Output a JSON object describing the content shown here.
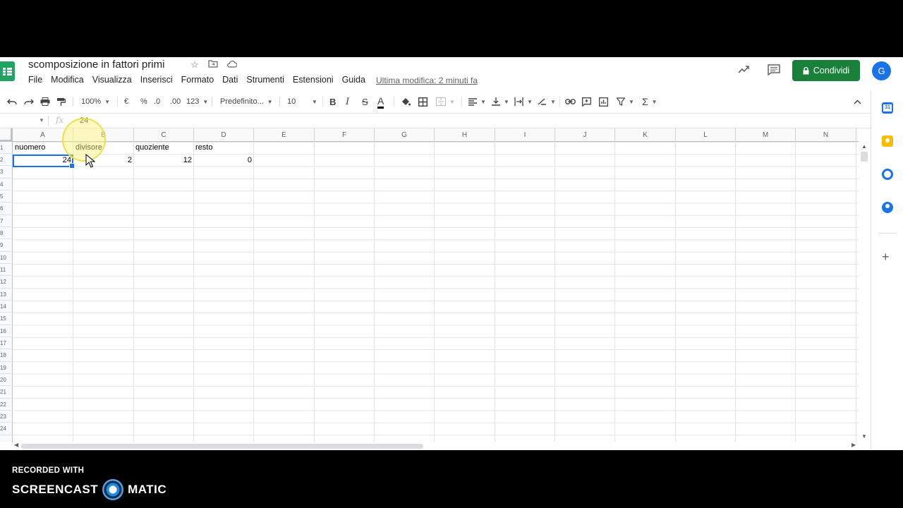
{
  "document": {
    "title": "scomposizione in fattori primi",
    "last_edit": "Ultima modifica: 2 minuti fa"
  },
  "menu": [
    "File",
    "Modifica",
    "Visualizza",
    "Inserisci",
    "Formato",
    "Dati",
    "Strumenti",
    "Estensioni",
    "Guida"
  ],
  "header": {
    "share_label": "Condividi",
    "avatar_letter": "G",
    "share_color": "#188038"
  },
  "toolbar": {
    "zoom": "100%",
    "currency": "€",
    "percent": "%",
    "decrease_decimals": ".0",
    "increase_decimals": ".00",
    "more_formats": "123",
    "font": "Predefinito...",
    "font_size": "10"
  },
  "formula_bar": {
    "fx": "fx",
    "value": "24"
  },
  "columns": [
    "A",
    "B",
    "C",
    "D",
    "E",
    "F",
    "G",
    "H",
    "I",
    "J",
    "K",
    "L",
    "M",
    "N"
  ],
  "rows": [
    "1",
    "2",
    "3",
    "4",
    "5",
    "6",
    "7",
    "8",
    "9",
    "10",
    "11",
    "12",
    "13",
    "14",
    "15",
    "16",
    "17",
    "18",
    "19",
    "20",
    "21",
    "22",
    "23",
    "24"
  ],
  "sheet": {
    "headers": [
      "nuomero",
      "divisore",
      "quoziente",
      "resto"
    ],
    "values": [
      "24",
      "2",
      "12",
      "0"
    ],
    "selected_cell": "A2"
  },
  "watermark": {
    "line1": "RECORDED WITH",
    "brand_left": "SCREENCAST",
    "brand_right": "MATIC"
  },
  "colors": {
    "selection": "#1a73e8",
    "sheets_green": "#1fa463"
  }
}
